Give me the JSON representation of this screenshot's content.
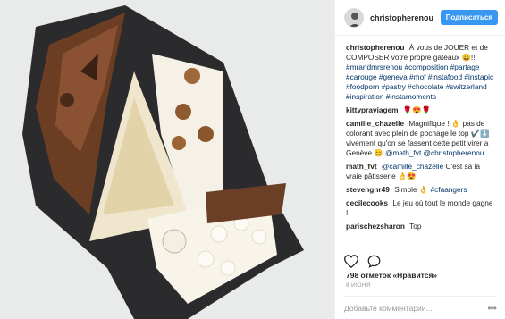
{
  "post": {
    "username": "christopherenou",
    "follow_label": "Подписаться",
    "caption_user": "christopherenou",
    "caption_text": "À vous de JOUER et de COMPOSER votre propre gâteaux",
    "caption_emoji": "😀!!!",
    "caption_tags": "#mrandmrsrenou #composition #partage #carouge #geneva #mof #instafood #instapic #foodporn #pastry #chocolate #switzerland #inspiration #instamoments"
  },
  "comments": [
    {
      "user": "kittypraviagem",
      "text": "🌹😍🌹"
    },
    {
      "user": "camille_chazelle",
      "text": "Magnifique ! 👌 pas de colorant avec plein de pochage le top ✔️⬇️ vivement qu'on se fassent cette petit virer a Genève 😊",
      "mentions": "@math_fvt @christopherenou"
    },
    {
      "user": "math_fvt",
      "mention": "@camille_chazelle",
      "text": "C'est sa la vraie pâtisserie 👌😍"
    },
    {
      "user": "stevengnr49",
      "text": "Simple 👌",
      "tag": "#cfaangers"
    },
    {
      "user": "cecilecooks",
      "text": "Le jeu où tout le monde gagne !"
    },
    {
      "user": "parischezsharon",
      "text": "Top"
    }
  ],
  "stats": {
    "likes": "798 отметок «Нравится»",
    "date": "8 ИЮНЯ"
  },
  "add_comment": {
    "placeholder": "Добавьте комментарий..."
  },
  "icons": [
    "heart-icon",
    "comment-icon",
    "more-icon"
  ]
}
